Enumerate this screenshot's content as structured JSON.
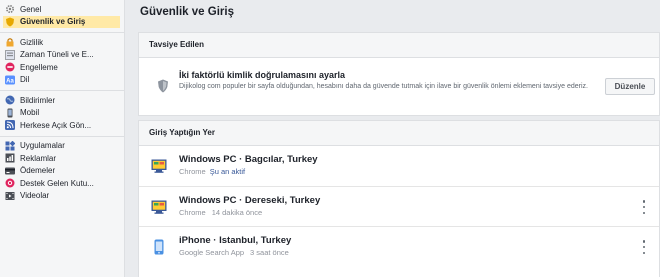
{
  "sidebar": {
    "groups": [
      {
        "items": [
          {
            "label": "Genel",
            "icon": "gear-icon"
          },
          {
            "label": "Güvenlik ve Giriş",
            "icon": "shield-icon",
            "active": true
          }
        ]
      },
      {
        "items": [
          {
            "label": "Gizlilik",
            "icon": "lock-icon"
          },
          {
            "label": "Zaman Tüneli ve E...",
            "icon": "timeline-icon"
          },
          {
            "label": "Engelleme",
            "icon": "block-icon"
          },
          {
            "label": "Dil",
            "icon": "language-icon"
          }
        ]
      },
      {
        "items": [
          {
            "label": "Bildirimler",
            "icon": "globe-icon"
          },
          {
            "label": "Mobil",
            "icon": "mobile-icon"
          },
          {
            "label": "Herkese Açık Gön...",
            "icon": "rss-icon"
          }
        ]
      },
      {
        "items": [
          {
            "label": "Uygulamalar",
            "icon": "apps-icon"
          },
          {
            "label": "Reklamlar",
            "icon": "ads-icon"
          },
          {
            "label": "Ödemeler",
            "icon": "payments-icon"
          },
          {
            "label": "Destek Gelen Kutu...",
            "icon": "support-inbox-icon"
          },
          {
            "label": "Videolar",
            "icon": "video-icon"
          }
        ]
      }
    ]
  },
  "main": {
    "title": "Güvenlik ve Giriş",
    "recommended": {
      "header": "Tavsiye Edilen",
      "title": "İki faktörlü kimlik doğrulamasını ayarla",
      "description": "Dijikolog com populer bir sayfa olduğundan, hesabını daha da güvende tutmak için ilave bir güvenlik önlemi eklemeni tavsiye ederiz.",
      "button": "Düzenle"
    },
    "logins": {
      "header": "Giriş Yaptığın Yer",
      "sessions": [
        {
          "name": "Windows PC · Bagcılar, Turkey",
          "app": "Chrome",
          "status": "Şu an aktif",
          "time": "",
          "device": "desktop-icon"
        },
        {
          "name": "Windows PC · Dereseki, Turkey",
          "app": "Chrome",
          "status": "",
          "time": "14 dakika önce",
          "device": "desktop-icon"
        },
        {
          "name": "iPhone · Istanbul, Turkey",
          "app": "Google Search App",
          "status": "",
          "time": "3 saat önce",
          "device": "phone-icon"
        }
      ]
    }
  },
  "colors": {
    "active_item": "#ffe9a6",
    "link": "#385898",
    "muted": "#90949c"
  }
}
